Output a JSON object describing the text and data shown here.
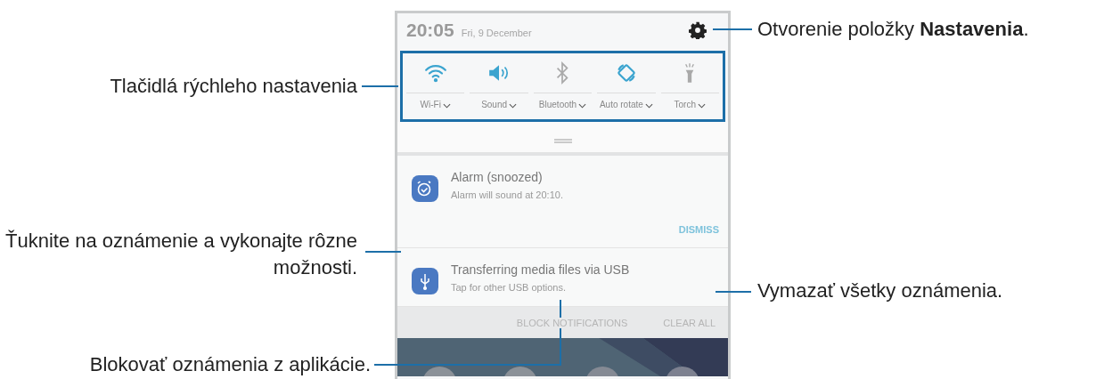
{
  "status_bar": {
    "time": "20:05",
    "date": "Fri, 9 December"
  },
  "quick_settings": [
    {
      "kind": "wifi",
      "label": "Wi-Fi",
      "on": true
    },
    {
      "kind": "sound",
      "label": "Sound",
      "on": true
    },
    {
      "kind": "bluetooth",
      "label": "Bluetooth",
      "on": false
    },
    {
      "kind": "rotate",
      "label": "Auto rotate",
      "on": true
    },
    {
      "kind": "torch",
      "label": "Torch",
      "on": false
    }
  ],
  "notifications": [
    {
      "kind": "alarm",
      "title": "Alarm (snoozed)",
      "text": "Alarm will sound at 20:10.",
      "action": "DISMISS"
    },
    {
      "kind": "usb",
      "title": "Transferring media files via USB",
      "text": "Tap for other USB options."
    }
  ],
  "actions": [
    "BLOCK NOTIFICATIONS",
    "CLEAR ALL"
  ],
  "callouts": [
    {
      "text": "Otvorenie položky **Nastavenia**."
    },
    {
      "text": "Tlačidlá rýchleho nastavenia"
    },
    {
      "text": "Ťuknite na oznámenie a vykonajte rôzne možnosti."
    },
    {
      "text": "Vymazať všetky oznámenia."
    },
    {
      "text": "Blokovať oznámenia z aplikácie."
    }
  ]
}
